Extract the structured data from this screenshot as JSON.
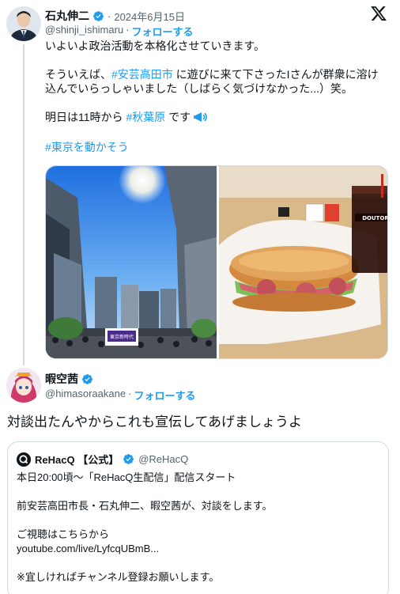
{
  "tweet": {
    "author_name": "石丸伸二",
    "separator": "·",
    "date": "2024年6月15日",
    "handle": "@shinji_ishimaru",
    "follow_label": "フォローする",
    "line1": "いよいよ政治活動を本格化させていきます。",
    "line2_a": "そういえば、",
    "line2_hashtag": "#安芸高田市",
    "line2_b": " に遊びに来て下さったIさんが群衆に溶け",
    "line3": "込んでいらっしゃいました（しばらく気づけなかった...）笑。",
    "line4_a": "明日は11時から ",
    "line4_hashtag": "#秋葉原",
    "line4_b": " です",
    "line5_hashtag": "#東京を動かそう",
    "photos": [
      {
        "alt": "Shibuya street with crowd and tall buildings under a bright sun",
        "poster_text": "東京新時代"
      },
      {
        "alt": "Sandwich with salami and lettuce on a tray with iced coffee",
        "cup_text": "DOUTOR"
      }
    ]
  },
  "reply": {
    "author_name": "暇空茜",
    "handle": "@himasoraakane",
    "separator": "·",
    "follow_label": "フォローする",
    "text": "対談出たんやからこれも宣伝してあげましょうよ"
  },
  "quote": {
    "author_name": "ReHacQ 【公式】",
    "handle": "@ReHacQ",
    "line1": "本日20:00頃〜「ReHacQ生配信」配信スタート",
    "line2": "前安芸高田市長・石丸伸二、暇空茜が、対談をします。",
    "line3": "ご視聴はこちらから",
    "line4": "youtube.com/live/LyfcqUBmB...",
    "line5": "※宜しければチャンネル登録お願いします。"
  },
  "colors": {
    "accent": "#1d9bf0",
    "text": "#0f1419",
    "secondary": "#536471",
    "border": "#cfd9de"
  },
  "icons": [
    "verified-badge-icon",
    "x-logo-icon",
    "megaphone-icon"
  ]
}
